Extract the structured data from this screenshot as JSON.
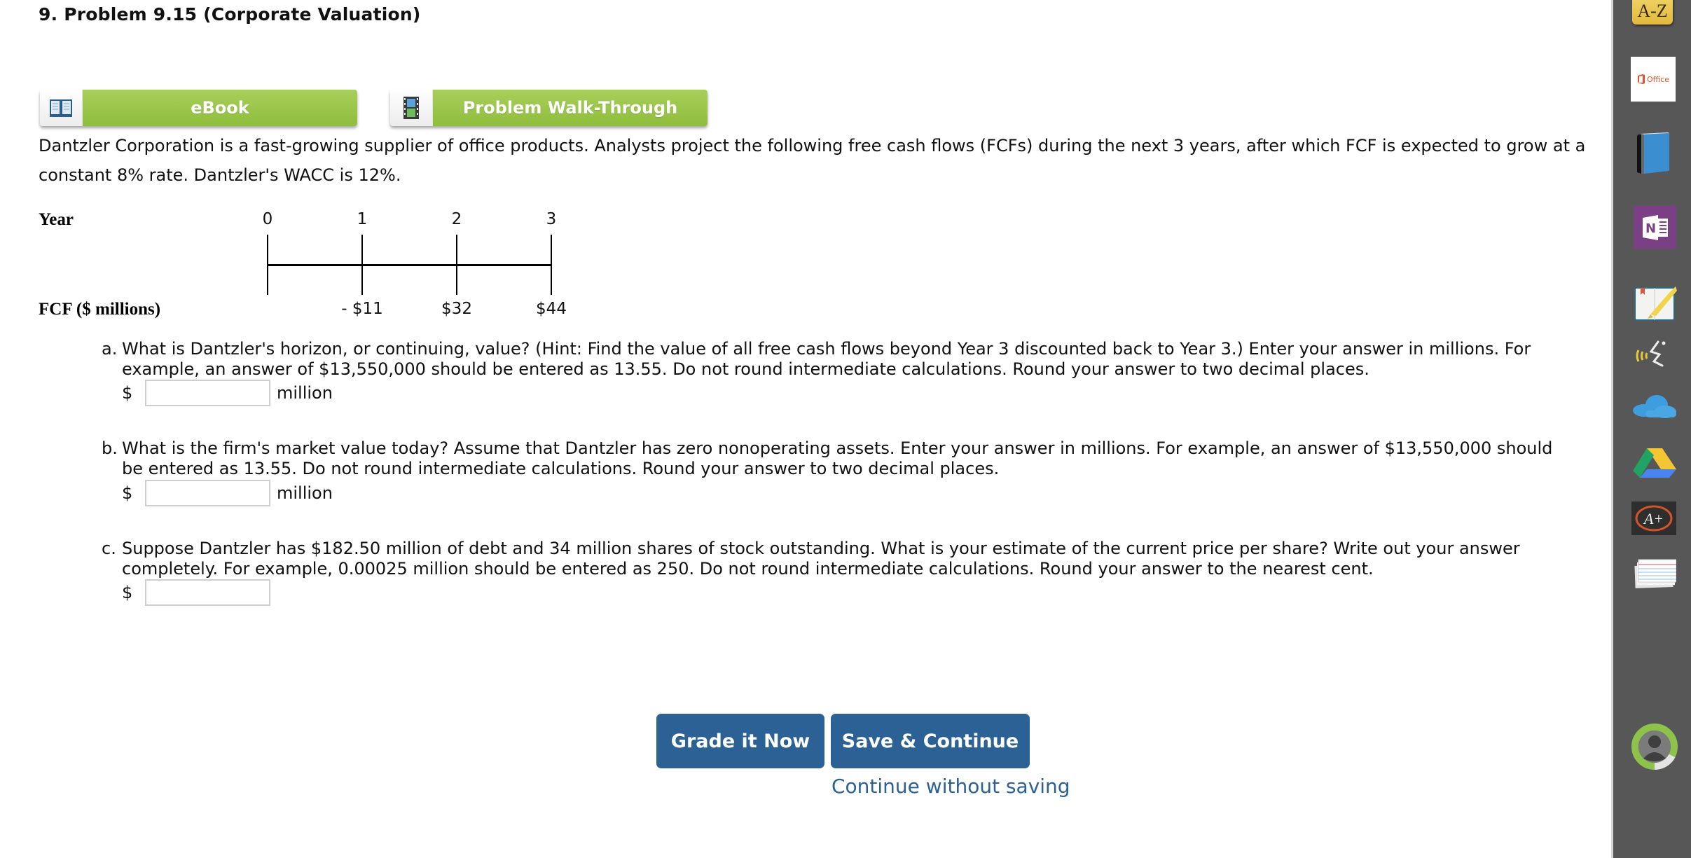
{
  "header": {
    "title": "9.  Problem 9.15 (Corporate Valuation)"
  },
  "resources": {
    "ebook": {
      "label": "eBook",
      "icon": "open-book-icon"
    },
    "walkthrough": {
      "label": "Problem Walk-Through",
      "icon": "film-strip-icon"
    }
  },
  "intro": {
    "text": "Dantzler Corporation is a fast-growing supplier of office products. Analysts project the following free cash flows (FCFs) during the next 3 years, after which FCF is expected to grow at a constant 8% rate. Dantzler's WACC is 12%."
  },
  "timeline": {
    "year_label": "Year",
    "fcf_label": "FCF ($ millions)",
    "years": [
      "0",
      "1",
      "2",
      "3"
    ],
    "fcfs": [
      "",
      "- $11",
      "$32",
      "$44"
    ]
  },
  "questions": [
    {
      "letter": "a.",
      "text": "What is Dantzler's horizon, or continuing, value? (Hint: Find the value of all free cash flows beyond Year 3 discounted back to Year 3.) Enter your answer in millions. For example, an answer of $13,550,000 should be entered as 13.55. Do not round intermediate calculations. Round your answer to two decimal places.",
      "currency": "$",
      "value": "",
      "unit": "million"
    },
    {
      "letter": "b.",
      "text": "What is the firm's market value today? Assume that Dantzler has zero nonoperating assets. Enter your answer in millions. For example, an answer of $13,550,000 should be entered as 13.55. Do not round intermediate calculations. Round your answer to two decimal places.",
      "currency": "$",
      "value": "",
      "unit": "million"
    },
    {
      "letter": "c.",
      "text": "Suppose Dantzler has $182.50 million of debt and 34 million shares of stock outstanding. What is your estimate of the current price per share? Write out your answer completely. For example, 0.00025 million should be entered as 250. Do not round intermediate calculations. Round your answer to the nearest cent.",
      "currency": "$",
      "value": "",
      "unit": ""
    }
  ],
  "actions": {
    "grade_label": "Grade it Now",
    "save_label": "Save & Continue",
    "continue_label": "Continue without saving"
  },
  "sidebar": {
    "items": [
      {
        "name": "a-z-glossary-icon",
        "label": "A-Z"
      },
      {
        "name": "office-icon",
        "label": "Office"
      },
      {
        "name": "book-icon",
        "label": ""
      },
      {
        "name": "onenote-icon",
        "label": "N"
      },
      {
        "name": "highlighter-notebook-icon",
        "label": ""
      },
      {
        "name": "read-aloud-icon",
        "label": ""
      },
      {
        "name": "onedrive-cloud-icon",
        "label": ""
      },
      {
        "name": "google-drive-icon",
        "label": ""
      },
      {
        "name": "a-plus-grade-icon",
        "label": "A+"
      },
      {
        "name": "flashcards-icon",
        "label": ""
      },
      {
        "name": "user-avatar-icon",
        "label": ""
      }
    ]
  },
  "colors": {
    "button_blue": "#2b6194",
    "resource_green": "#9bc64b",
    "sidebar_bg": "#575757"
  }
}
